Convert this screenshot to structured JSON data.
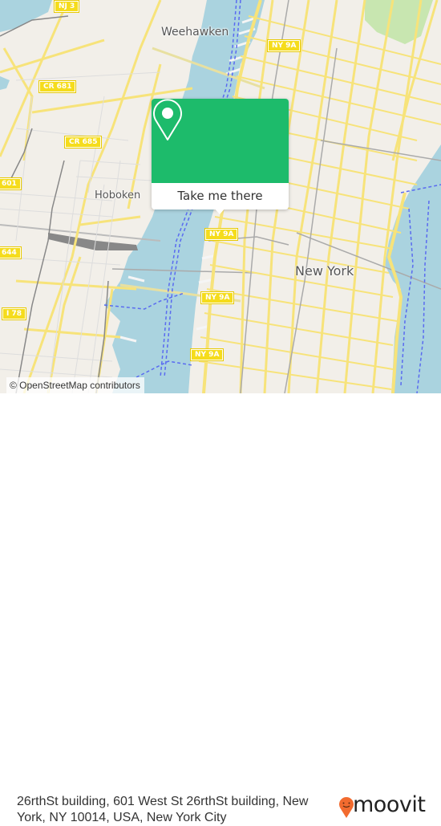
{
  "map": {
    "place_labels": {
      "weehawken": "Weehawken",
      "hoboken": "Hoboken",
      "new_york": "New York"
    },
    "route_shields": [
      {
        "id": "nj3",
        "label": "NJ 3"
      },
      {
        "id": "ny9a_top",
        "label": "NY 9A"
      },
      {
        "id": "cr681",
        "label": "CR 681"
      },
      {
        "id": "cr685",
        "label": "CR 685"
      },
      {
        "id": "cr601",
        "label": "601"
      },
      {
        "id": "ny9a_pointer",
        "label": "NY 9A"
      },
      {
        "id": "cr644",
        "label": "644"
      },
      {
        "id": "ny9a_mid",
        "label": "NY 9A"
      },
      {
        "id": "i78",
        "label": "I 78"
      },
      {
        "id": "ny9a_bottom",
        "label": "NY 9A"
      }
    ],
    "attribution": "© OpenStreetMap contributors",
    "colors": {
      "water": "#aad3df",
      "land": "#f2efe9",
      "road": "#f7e37a",
      "park": "#c8e6b0",
      "ferry": "#5a6bf0",
      "accent": "#1dbb6b"
    }
  },
  "popup": {
    "icon": "location-pin-icon",
    "button_label": "Take me there"
  },
  "footer": {
    "address": "26rthSt building, 601 West St 26rthSt building, New York, NY 10014, USA, New York City",
    "brand": "moovit",
    "brand_color": "#f26b2f"
  }
}
